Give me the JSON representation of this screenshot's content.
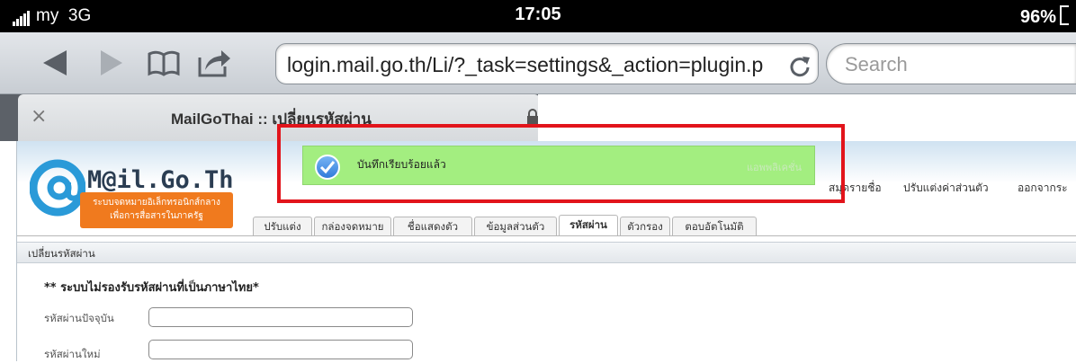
{
  "status": {
    "carrier": "my",
    "network": "3G",
    "time": "17:05",
    "battery": "96%"
  },
  "browser": {
    "url": "login.mail.go.th/Li/?_task=settings&_action=plugin.p",
    "search_placeholder": "Search",
    "tab_title": "MailGoThai :: เปลี่ยนรหัสผ่าน",
    "tab_close": "×"
  },
  "site": {
    "logo_title": "M@il.Go.Th",
    "logo_line1": "ระบบจดหมายอิเล็กทรอนิกส์กลาง",
    "logo_line2": "เพื่อการสื่อสารในภาครัฐ",
    "top_nav": [
      "สมุดรายชื่อ",
      "ปรับแต่งค่าส่วนตัว",
      "ออกจากระ"
    ],
    "tabs": [
      "ปรับแต่ง",
      "กล่องจดหมาย",
      "ชื่อแสดงตัว",
      "ข้อมูลส่วนตัว",
      "รหัสผ่าน",
      "ตัวกรอง",
      "ตอบอัตโนมัติ"
    ],
    "section_title": "เปลี่ยนรหัสผ่าน",
    "warning": "** ระบบไม่รองรับรหัสผ่านที่เป็นภาษาไทย*",
    "fields": [
      {
        "label": "รหัสผ่านปัจจุบัน",
        "value": ""
      },
      {
        "label": "รหัสผ่านใหม่",
        "value": ""
      }
    ]
  },
  "notification": {
    "message": "บันทึกเรียบร้อยแล้ว",
    "faded_text": "แอพพลิเคชั่น"
  },
  "colors": {
    "notification_bg": "#a3ee80",
    "highlight_box": "#e2141b",
    "logo_orange": "#f07a1e"
  }
}
